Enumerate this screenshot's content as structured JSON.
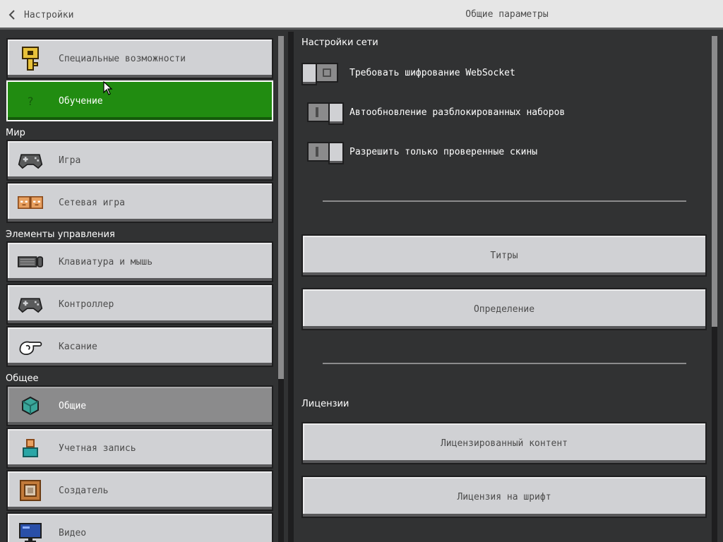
{
  "header": {
    "back_label": "Настройки",
    "title": "Общие параметры"
  },
  "left_nav": {
    "items_top": [
      {
        "label": "Специальные возможности",
        "icon": "key-icon"
      },
      {
        "label": "Обучение",
        "icon": "question-icon"
      }
    ],
    "section_world": "Мир",
    "items_world": [
      {
        "label": "Игра",
        "icon": "gamepad-icon"
      },
      {
        "label": "Сетевая игра",
        "icon": "players-icon"
      }
    ],
    "section_controls": "Элементы управления",
    "items_controls": [
      {
        "label": "Клавиатура и мышь",
        "icon": "keyboard-mouse-icon"
      },
      {
        "label": "Контроллер",
        "icon": "controller-icon"
      },
      {
        "label": "Касание",
        "icon": "touch-hand-icon"
      }
    ],
    "section_general": "Общее",
    "items_general": [
      {
        "label": "Общие",
        "icon": "cube-icon"
      },
      {
        "label": "Учетная запись",
        "icon": "account-icon"
      },
      {
        "label": "Создатель",
        "icon": "command-block-icon"
      },
      {
        "label": "Видео",
        "icon": "monitor-icon"
      }
    ]
  },
  "right_panel": {
    "network_header": "Настройки сети",
    "toggles": [
      {
        "label": "Требовать шифрование WebSocket",
        "state": "off"
      },
      {
        "label": "Автообновление разблокированных наборов",
        "state": "on"
      },
      {
        "label": "Разрешить только проверенные скины",
        "state": "on"
      }
    ],
    "buttons_top": [
      "Титры",
      "Определение"
    ],
    "licenses_header": "Лицензии",
    "buttons_licenses": [
      "Лицензированный контент",
      "Лицензия на шрифт"
    ]
  },
  "colors": {
    "background": "#313233",
    "button_face": "#d0d1d4",
    "selected_green": "#218c11",
    "active_gray": "#8b8b8c",
    "title_bar": "#e6e6e6"
  }
}
